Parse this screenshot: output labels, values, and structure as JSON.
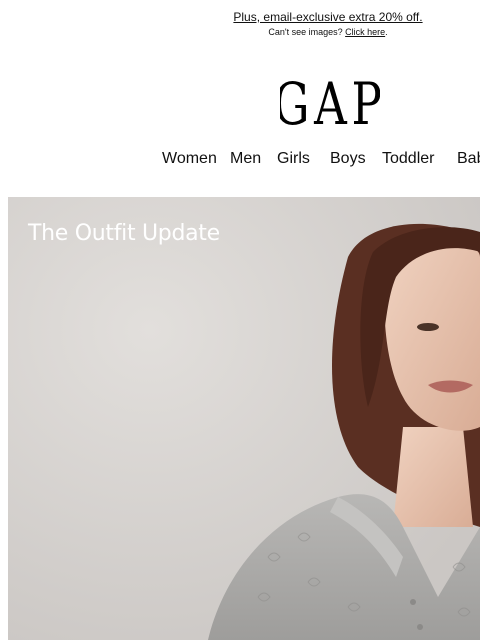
{
  "header": {
    "promo_text": "Plus, email-exclusive extra 20% off.",
    "cant_see_prefix": "Can't see images?",
    "click_here": "Click here",
    "cant_see_suffix": "."
  },
  "logo": {
    "text": "GAP"
  },
  "nav": {
    "items": [
      "Women",
      "Men",
      "Girls",
      "Boys",
      "Toddler",
      "Baby"
    ]
  },
  "hero": {
    "title": "The Outfit Update"
  },
  "colors": {
    "hero_background": "#d7d3d0",
    "hair": "#5a2f22",
    "sweater": "#a9a8a6",
    "skin": "#e6c2ad",
    "text": "#111111"
  }
}
